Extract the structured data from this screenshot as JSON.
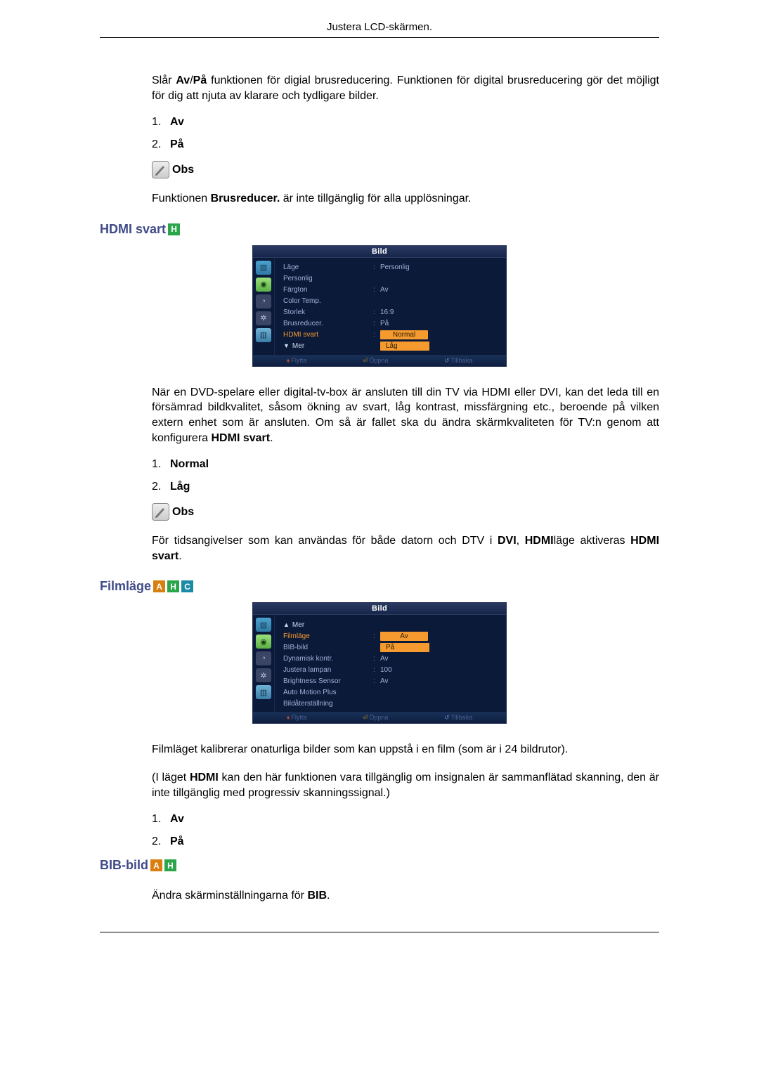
{
  "header": {
    "title": "Justera LCD-skärmen."
  },
  "s1": {
    "intro_a": "Slår ",
    "intro_b": "Av",
    "intro_c": "/",
    "intro_d": "På",
    "intro_e": " funktionen för digial brusreducering. Funktionen för digital brusreducering gör det möjligt för dig att njuta av klarare och tydligare bilder.",
    "li1": "Av",
    "li2": "På",
    "obs": "Obs",
    "note_a": "Funktionen ",
    "note_b": "Brusreducer.",
    "note_c": " är inte tillgänglig för alla upplösningar."
  },
  "hdmi": {
    "title": "HDMI svart",
    "badge": "H",
    "p1": "När en DVD-spelare eller digital-tv-box är ansluten till din TV via HDMI eller DVI, kan det leda till en försämrad bildkvalitet, såsom ökning av svart, låg kontrast, missfärgning etc., beroende på vilken extern enhet som är ansluten. Om så är fallet ska du ändra skärmkvaliteten för TV:n genom att konfigurera ",
    "p1b": "HDMI svart",
    "p1c": ".",
    "li1": "Normal",
    "li2": "Låg",
    "obs": "Obs",
    "n2a": "För tidsangivelser som kan användas för både datorn och DTV i ",
    "n2b": "DVI",
    "n2c": ", ",
    "n2d": "HDMI",
    "n2e": "läge aktiveras ",
    "n2f": "HDMI svart",
    "n2g": "."
  },
  "film": {
    "title": "Filmläge",
    "badgeA": "A",
    "badgeH": "H",
    "badgeC": "C",
    "p1": "Filmläget kalibrerar onaturliga bilder som kan uppstå i en film (som är i 24 bildrutor).",
    "p2a": "(I läget ",
    "p2b": "HDMI",
    "p2c": " kan den här funktionen vara tillgänglig om insignalen är sammanflätad skanning, den är inte tillgänglig med progressiv skanningssignal.)",
    "li1": "Av",
    "li2": "På"
  },
  "bib": {
    "title": "BIB-bild",
    "badgeA": "A",
    "badgeH": "H",
    "p1a": "Ändra skärminställningarna för ",
    "p1b": "BIB",
    "p1c": "."
  },
  "osd1": {
    "title": "Bild",
    "rows": [
      {
        "label": "Läge",
        "val": "Personlig",
        "colon": ":"
      },
      {
        "label": "Personlig",
        "val": "",
        "colon": ""
      },
      {
        "label": "Färgton",
        "val": "Av",
        "colon": ":"
      },
      {
        "label": "Color Temp.",
        "val": "",
        "colon": ""
      },
      {
        "label": "Storlek",
        "val": "16:9",
        "colon": ":"
      },
      {
        "label": "Brusreducer.",
        "val": "På",
        "colon": ":"
      }
    ],
    "hl_label": "HDMI svart",
    "sel": "Normal",
    "below": "Låg",
    "more": "Mer",
    "f1": "Flytta",
    "f2": "Öppna",
    "f3": "Tillbaka"
  },
  "osd2": {
    "title": "Bild",
    "more": "Mer",
    "hl_label": "Filmläge",
    "sel": "Av",
    "below": "På",
    "rows": [
      {
        "label": "BIB-bild",
        "val": "",
        "colon": ""
      },
      {
        "label": "Dynamisk kontr.",
        "val": "Av",
        "colon": ":"
      },
      {
        "label": "Justera lampan",
        "val": "100",
        "colon": ":"
      },
      {
        "label": "Brightness Sensor",
        "val": "Av",
        "colon": ":"
      },
      {
        "label": "Auto Motion Plus",
        "val": "",
        "colon": ""
      },
      {
        "label": "Bildåterställning",
        "val": "",
        "colon": ""
      }
    ],
    "f1": "Flytta",
    "f2": "Öppna",
    "f3": "Tillbaka"
  }
}
